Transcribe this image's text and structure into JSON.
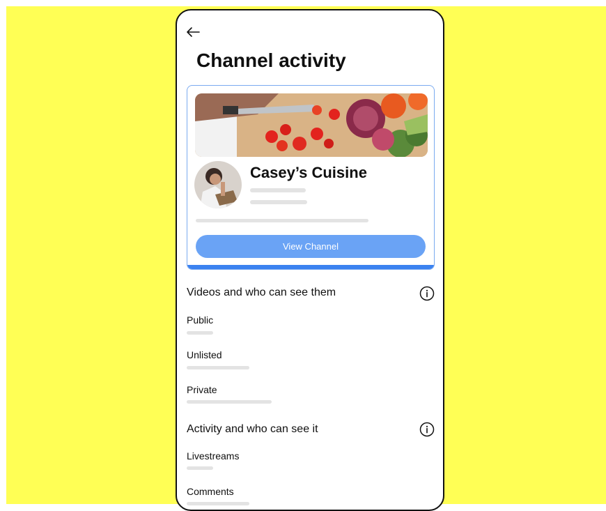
{
  "page": {
    "title": "Channel activity",
    "back_icon": "arrow-left-icon"
  },
  "channel_card": {
    "name": "Casey’s Cuisine",
    "button_label": "View Channel",
    "accent_color": "#3b82f0",
    "button_color": "#6aa3f5"
  },
  "sections": [
    {
      "heading": "Videos and who can see them",
      "icon": "info-icon",
      "items": [
        {
          "label": "Public"
        },
        {
          "label": "Unlisted"
        },
        {
          "label": "Private"
        }
      ]
    },
    {
      "heading": "Activity and who can see it",
      "icon": "info-icon",
      "items": [
        {
          "label": "Livestreams"
        },
        {
          "label": "Comments"
        }
      ]
    }
  ],
  "colors": {
    "background": "#ffff55",
    "skeleton": "#e3e3e3"
  }
}
